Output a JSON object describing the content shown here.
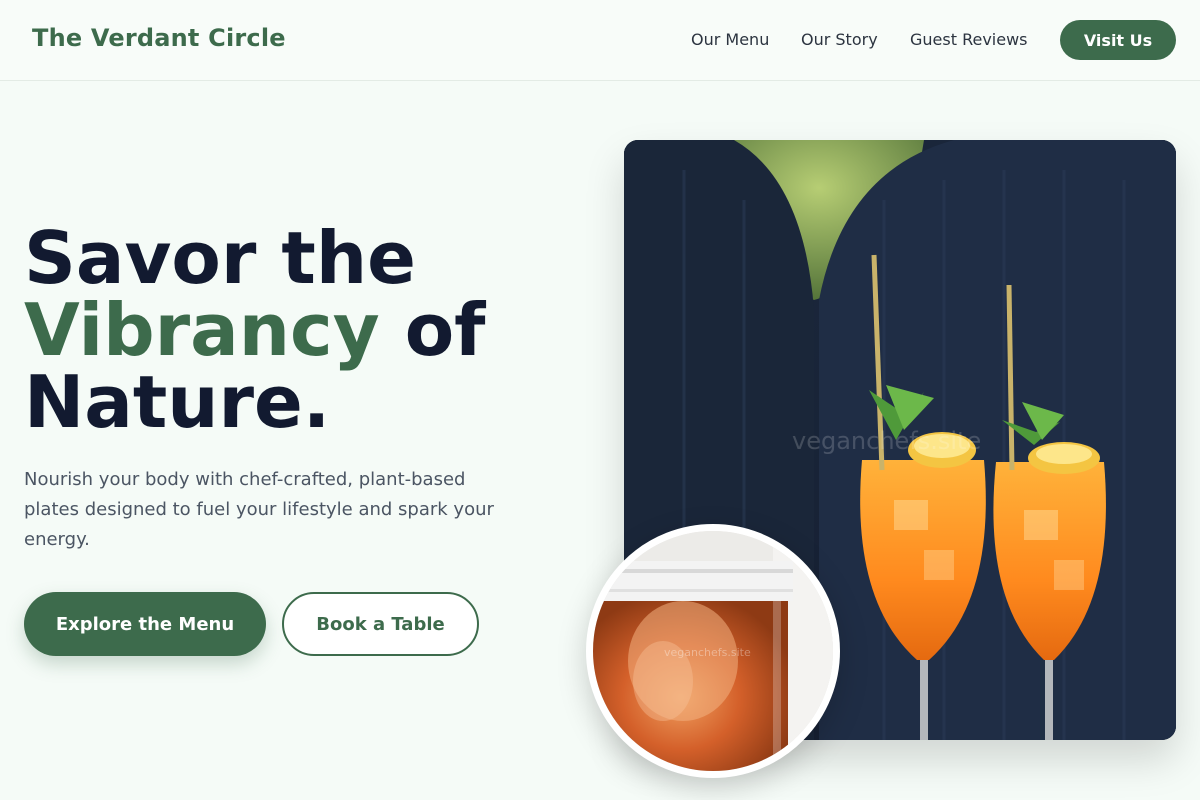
{
  "header": {
    "brand": "The Verdant Circle",
    "nav": [
      "Our Menu",
      "Our Story",
      "Guest Reviews"
    ],
    "cta": "Visit Us"
  },
  "hero": {
    "title_line1": "Savor the",
    "title_accent": "Vibrancy",
    "title_rest": " of",
    "title_line3": "Nature.",
    "subtitle": "Nourish your body with chef-crafted, plant-based plates designed to fuel your lifestyle and spark your energy.",
    "primary_button": "Explore the Menu",
    "secondary_button": "Book a Table"
  },
  "images": {
    "main_alt": "Two orange iced cocktails with mint, lime and straws",
    "main_watermark": "veganchefs.site",
    "circle_alt": "Jar of fermented tea with a scoby",
    "circle_watermark": "veganchefs.site"
  },
  "colors": {
    "brand_green": "#3d6b4c",
    "heading_dark": "#121a30",
    "background": "#f5fbf7"
  }
}
